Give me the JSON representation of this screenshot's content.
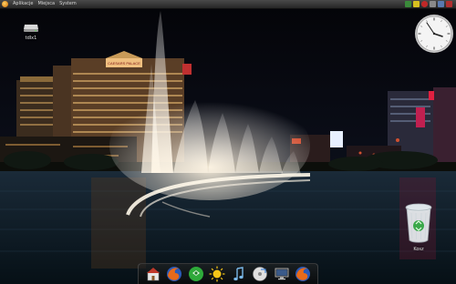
{
  "top_panel": {
    "menus": [
      "Aplikacje",
      "Miejsca",
      "System"
    ]
  },
  "desktop": {
    "icons": [
      {
        "label": "tdlx1",
        "icon": "drive-icon"
      },
      {
        "label": "Kosz",
        "icon": "trash-icon"
      }
    ]
  },
  "wallpaper": {
    "signs": [
      "CAESARS PALACE"
    ]
  },
  "dock": {
    "items": [
      "home-folder-icon",
      "firefox-icon",
      "chat-icon",
      "weather-icon",
      "music-icon",
      "disk-utility-icon",
      "monitor-icon",
      "firefox-icon"
    ]
  },
  "colors": {
    "panel": "#333333",
    "sky": "#0a0a14",
    "water": "#0d1e2a"
  }
}
